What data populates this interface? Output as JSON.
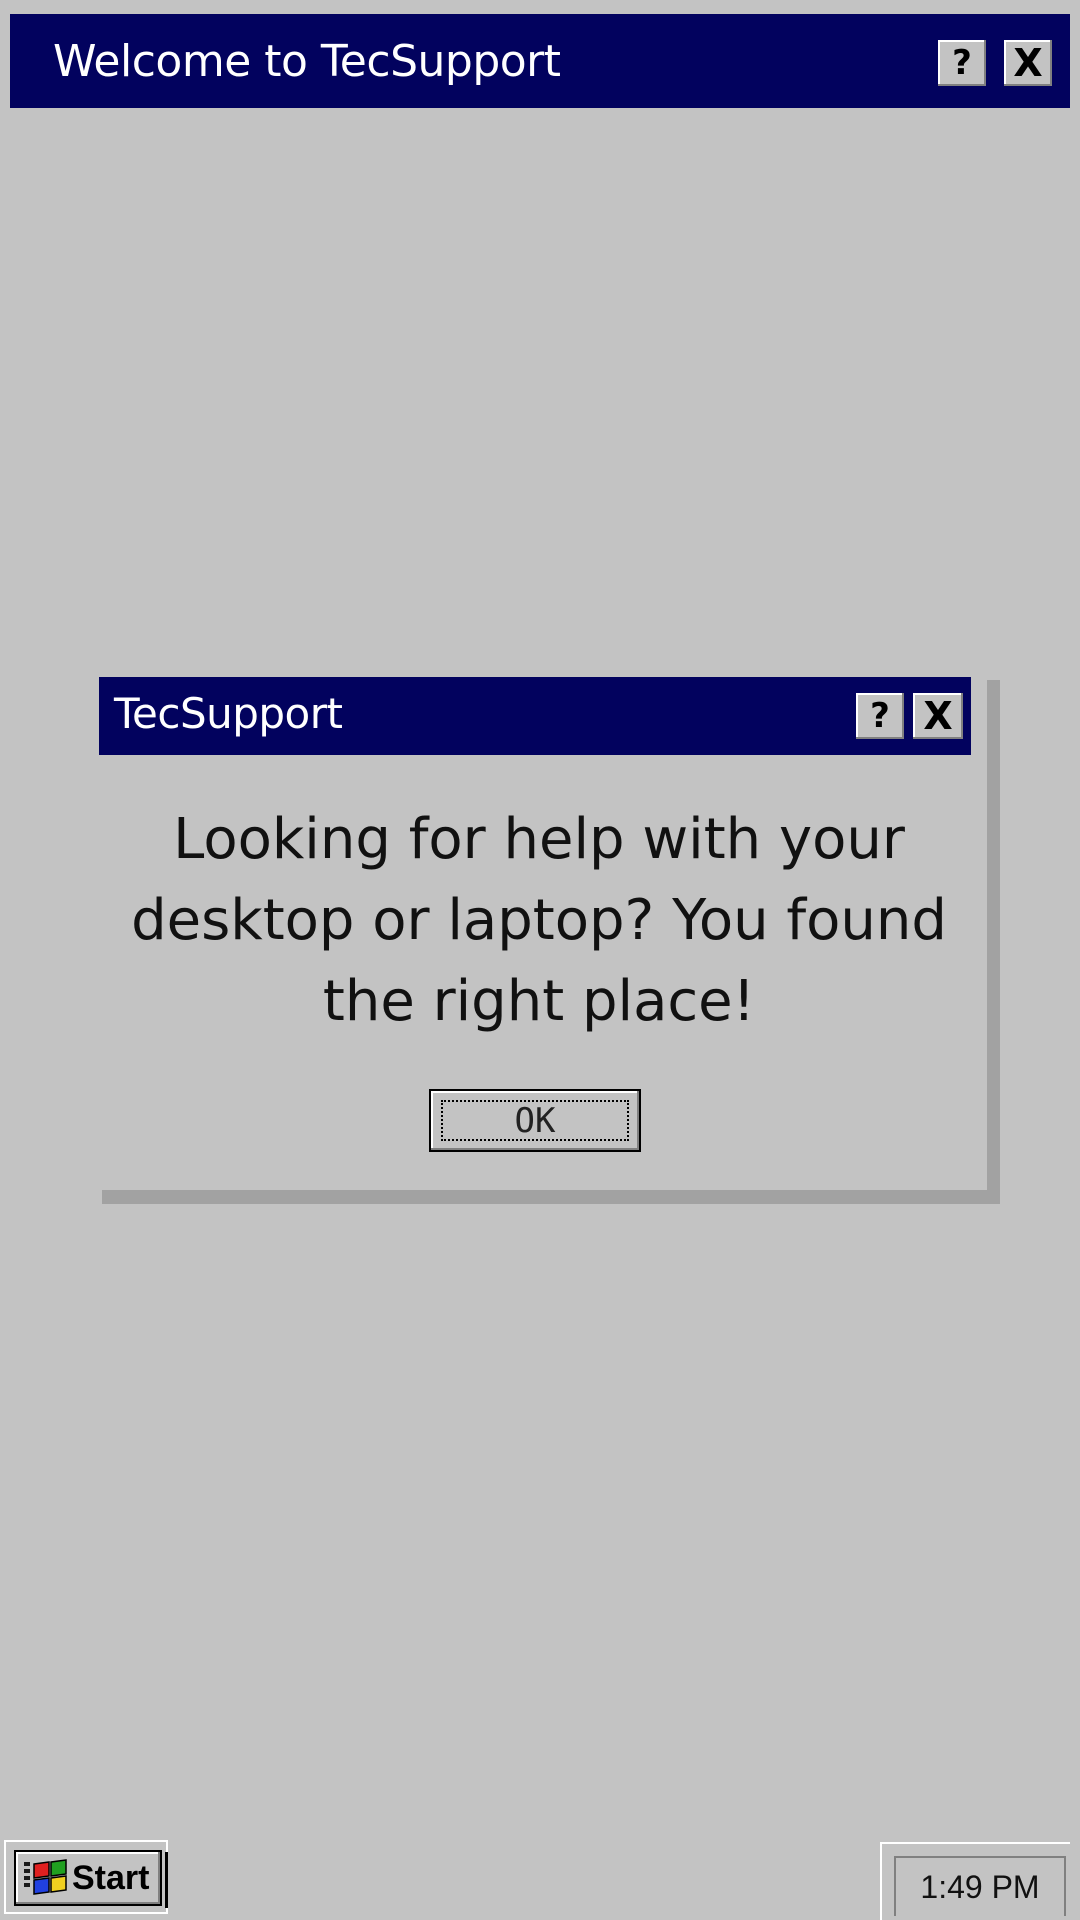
{
  "main_window": {
    "title": "Welcome to TecSupport",
    "help_label": "?",
    "close_label": "X"
  },
  "dialog": {
    "title": "TecSupport",
    "help_label": "?",
    "close_label": "X",
    "message": "Looking for help with your desktop or laptop? You found the right place!",
    "ok_label": "OK"
  },
  "taskbar": {
    "start_label": "Start",
    "clock": "1:49 PM"
  },
  "colors": {
    "titlebar": "#02025e",
    "desktop": "#c3c3c3"
  }
}
